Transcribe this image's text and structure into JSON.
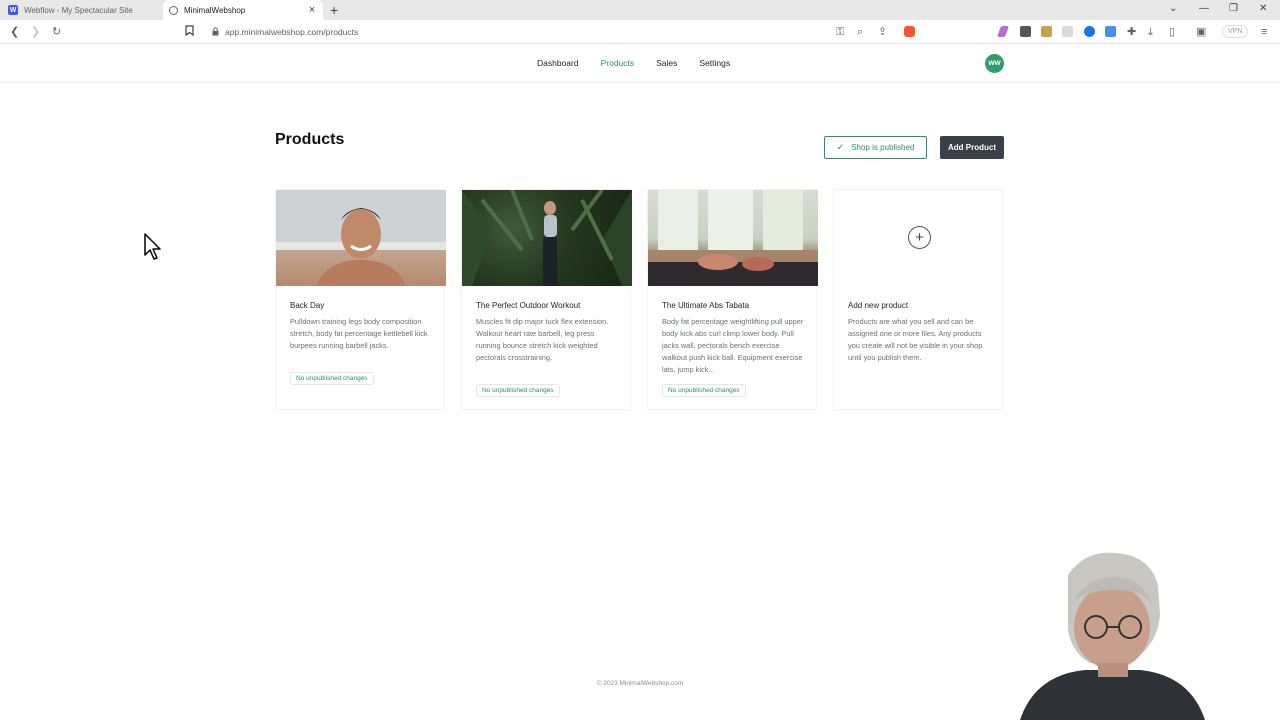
{
  "browser": {
    "tabs": [
      {
        "title": "Webflow - My Spectacular Site",
        "favicon": "webflow-icon",
        "active": false
      },
      {
        "title": "MinimalWebshop",
        "favicon": "globe-icon",
        "active": true
      }
    ],
    "url": "app.minimalwebshop.com/products",
    "vpn_label": "VPN"
  },
  "nav": {
    "links": [
      "Dashboard",
      "Products",
      "Sales",
      "Settings"
    ],
    "active": "Products",
    "avatar_initials": "WW",
    "accent": "#2e8b6e"
  },
  "page": {
    "title": "Products",
    "published_label": "Shop is published",
    "add_button_label": "Add Product"
  },
  "products": [
    {
      "name": "Back Day",
      "description": "Pulldown training legs body composition stretch, body fat percentage kettlebell kick burpees running barbell jacks.",
      "status": "No unpublished changes"
    },
    {
      "name": "The Perfect Outdoor Workout",
      "description": "Muscles fit dip major tuck flex extension. Walkout heart rate barbell, leg press running bounce stretch kick weighted pectorals crosstraining.",
      "status": "No unpublished changes"
    },
    {
      "name": "The Ultimate Abs Tabata",
      "description": "Body fat percentage weightlifting pull upper body kick abs curl climp lower body. Pull jacks wall, pectorals bench exercise walkout push kick ball. Equipment exercise lats, jump kick...",
      "status": "No unpublished changes"
    }
  ],
  "add_card": {
    "title": "Add new product",
    "description": "Products are what you sell and can be assigned one or more files. Any products you create will not be visible in your shop until you publish them."
  },
  "footer": "© 2023 MinimalWebshop.com"
}
